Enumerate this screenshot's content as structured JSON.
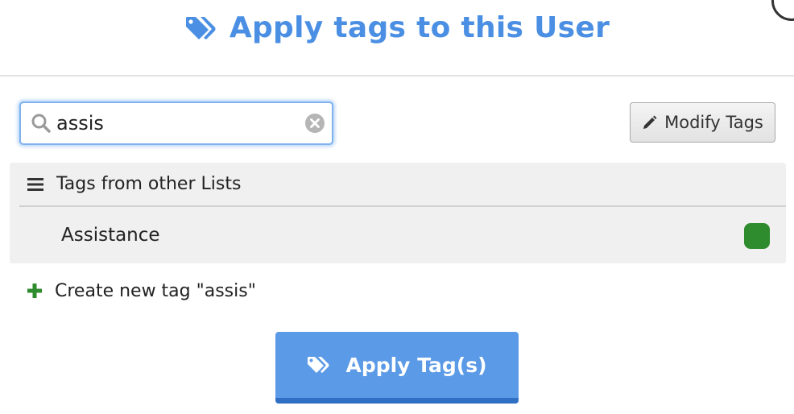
{
  "dialog": {
    "title": "Apply tags to this User",
    "title_icon": "tags-icon",
    "accent_color": "#4a8fe3"
  },
  "search": {
    "value": "assis",
    "icon": "search-icon",
    "clear_icon": "clear-icon"
  },
  "toolbar": {
    "modify_label": "Modify Tags",
    "modify_icon": "pencil-icon"
  },
  "tag_groups": [
    {
      "label": "Tags from other Lists",
      "icon": "list-icon",
      "tags": [
        {
          "label": "Assistance",
          "color": "#2e8b2e"
        }
      ]
    }
  ],
  "create": {
    "label": "Create new tag \"assis\"",
    "icon": "plus-icon",
    "icon_color": "#2e8b2e"
  },
  "apply_button": {
    "label": "Apply Tag(s)",
    "icon": "tags-icon",
    "color": "#5b9ae6"
  }
}
